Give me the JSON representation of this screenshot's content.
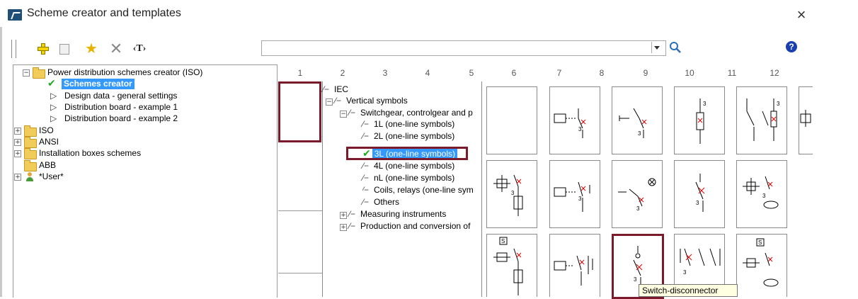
{
  "window": {
    "title": "Scheme creator and templates",
    "close": "×"
  },
  "toolbar": {
    "add_icon": "add-icon",
    "properties_icon": "properties-icon",
    "favorite_icon": "star-icon",
    "delete_icon": "delete-icon",
    "text_label": "‹T›"
  },
  "search": {
    "value": "",
    "placeholder": "",
    "help": "?"
  },
  "template_tree": {
    "root": "Power distribution schemes creator (ISO)",
    "selected": "Schemes creator",
    "children": [
      "Design data - general settings",
      "Distribution board - example 1",
      "Distribution board - example 2"
    ],
    "groups": [
      "ISO",
      "ANSI",
      "Installation boxes schemes",
      "ABB",
      "*User*"
    ]
  },
  "columns": [
    "1",
    "2",
    "3",
    "4",
    "5",
    "6",
    "7",
    "8",
    "9",
    "10",
    "11",
    "12"
  ],
  "symbol_tree": {
    "iec": "IEC",
    "vertical": "Vertical symbols",
    "switchgear": "Switchgear, controlgear and p",
    "items": [
      "1L (one-line symbols)",
      "2L (one-line symbols)",
      "3L (one-line symbols)",
      "4L (one-line symbols)",
      "nL (one-line symbols)",
      "Coils, relays (one-line sym",
      "Others"
    ],
    "measuring": "Measuring instruments",
    "production": "Production and conversion of"
  },
  "grid": {
    "cell_labels": [
      "3",
      "3",
      "3",
      "3",
      "3",
      "3",
      "3",
      "3",
      "3",
      "3",
      "3",
      "S",
      "S"
    ]
  },
  "tooltip": "Switch-disconnector",
  "colors": {
    "selection": "#3399ff",
    "highlight": "#7a1a2a",
    "check": "#1fa81f"
  }
}
